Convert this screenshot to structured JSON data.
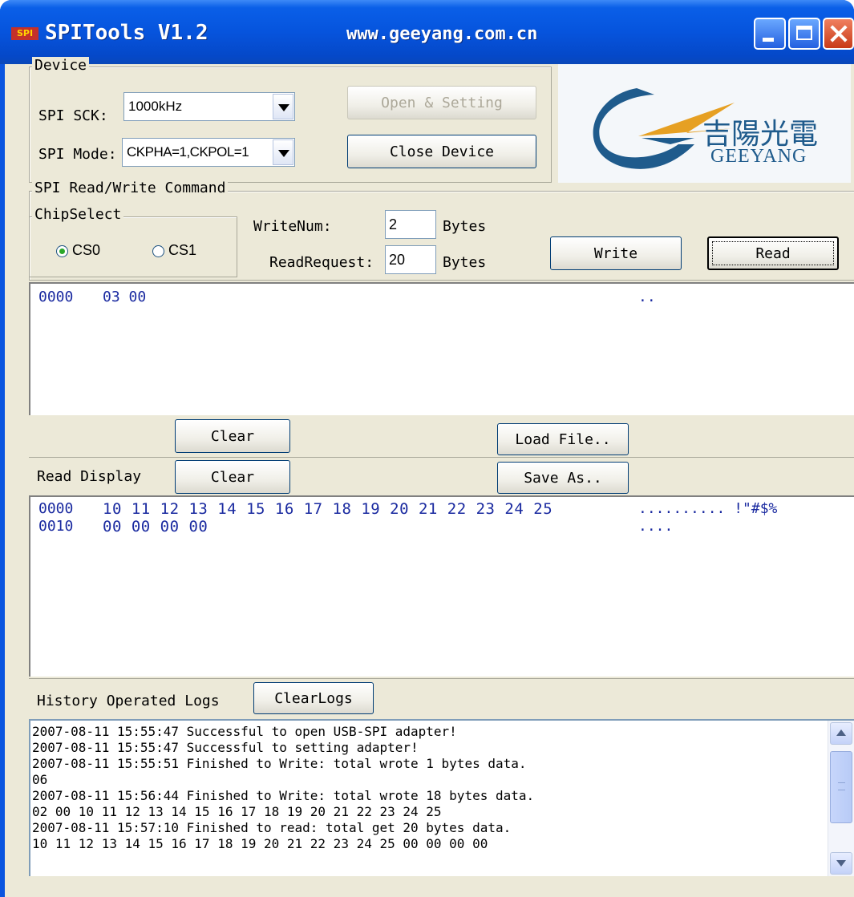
{
  "window": {
    "icon_text": "SPI",
    "title": "SPITools V1.2",
    "url": "www.geeyang.com.cn"
  },
  "device": {
    "group_label": "Device",
    "sck_label": "SPI SCK:",
    "sck_value": "1000kHz",
    "mode_label": "SPI Mode:",
    "mode_value": "CKPHA=1,CKPOL=1",
    "open_button": "Open & Setting",
    "close_button": "Close Device"
  },
  "logo": {
    "chinese": "吉陽光電",
    "english": "GEEYANG"
  },
  "command": {
    "group_label": "SPI Read/Write Command",
    "chip_select_label": "ChipSelect",
    "cs0_label": "CS0",
    "cs1_label": "CS1",
    "selected_cs": "CS0",
    "write_num_label": "WriteNum:",
    "write_num_value": "2",
    "read_request_label": "ReadRequest:",
    "read_request_value": "20",
    "bytes_label": "Bytes",
    "write_button": "Write",
    "read_button": "Read"
  },
  "write_pane": {
    "rows": [
      {
        "addr": "0000",
        "hex": "03 00",
        "ascii": ".."
      }
    ],
    "clear_button": "Clear",
    "load_button": "Load File.."
  },
  "read_pane": {
    "label": "Read Display",
    "clear_button": "Clear",
    "save_button": "Save As..",
    "rows": [
      {
        "addr": "0000",
        "hex": "10 11 12 13 14 15 16 17 18 19 20 21 22 23 24 25",
        "ascii": ".......... !\"#$%"
      },
      {
        "addr": "0010",
        "hex": "00 00 00 00",
        "ascii": "...."
      }
    ]
  },
  "logs": {
    "label": "History Operated Logs",
    "clear_button": "ClearLogs",
    "lines": [
      "2007-08-11 15:55:47 Successful to open USB-SPI adapter!",
      "2007-08-11 15:55:47 Successful to setting adapter!",
      "2007-08-11 15:55:51 Finished to Write: total wrote 1 bytes data.",
      "06",
      "2007-08-11 15:56:44 Finished to Write: total wrote 18 bytes data.",
      "02 00 10 11 12 13 14 15 16 17 18 19 20 21 22 23 24 25",
      "2007-08-11 15:57:10 Finished to read: total get 20 bytes data.",
      "10 11 12 13 14 15 16 17 18 19 20 21 22 23 24 25 00 00 00 00"
    ]
  }
}
